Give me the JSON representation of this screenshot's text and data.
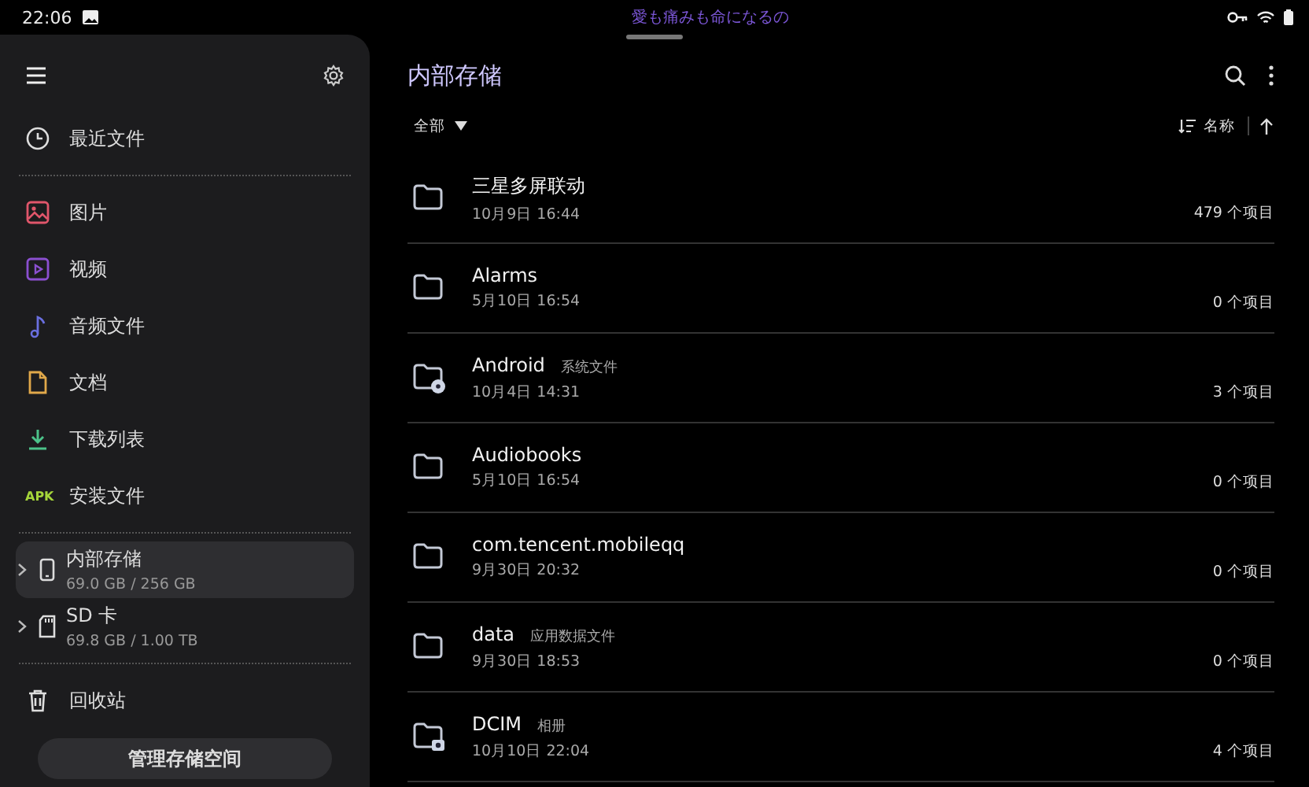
{
  "status_bar": {
    "time": "22:06",
    "notification": "愛も痛みも命になるの"
  },
  "sidebar": {
    "sections": [
      [
        {
          "kind": "recent",
          "label": "最近文件"
        }
      ],
      [
        {
          "kind": "images",
          "label": "图片"
        },
        {
          "kind": "videos",
          "label": "视频"
        },
        {
          "kind": "audio",
          "label": "音频文件"
        },
        {
          "kind": "documents",
          "label": "文档"
        },
        {
          "kind": "downloads",
          "label": "下载列表"
        },
        {
          "kind": "apk",
          "label": "安装文件",
          "badge": "APK"
        }
      ],
      [
        {
          "kind": "phone",
          "label": "内部存储",
          "detail": "69.0 GB / 256 GB",
          "selected": true
        },
        {
          "kind": "sdcard",
          "label": "SD 卡",
          "detail": "69.8 GB / 1.00 TB",
          "selected": false
        }
      ],
      [
        {
          "kind": "trash",
          "label": "回收站"
        }
      ]
    ],
    "button": "管理存储空间"
  },
  "main": {
    "title": "内部存储",
    "filter": "全部",
    "sort": "名称",
    "rows": [
      {
        "kind": "folder",
        "name": "三星多屏联动",
        "date": "10月9日 16:44",
        "count": "479 个项目"
      },
      {
        "kind": "folder",
        "name": "Alarms",
        "date": "5月10日 16:54",
        "count": "0 个项目"
      },
      {
        "kind": "system",
        "name": "Android",
        "tag": "系统文件",
        "date": "10月4日 14:31",
        "count": "3 个项目"
      },
      {
        "kind": "folder",
        "name": "Audiobooks",
        "date": "5月10日 16:54",
        "count": "0 个项目"
      },
      {
        "kind": "folder",
        "name": "com.tencent.mobileqq",
        "date": "9月30日 20:32",
        "count": "0 个项目"
      },
      {
        "kind": "folder",
        "name": "data",
        "tag": "应用数据文件",
        "date": "9月30日 18:53",
        "count": "0 个项目"
      },
      {
        "kind": "camera",
        "name": "DCIM",
        "tag": "相册",
        "date": "10月10日 22:04",
        "count": "4 个项目"
      }
    ]
  }
}
